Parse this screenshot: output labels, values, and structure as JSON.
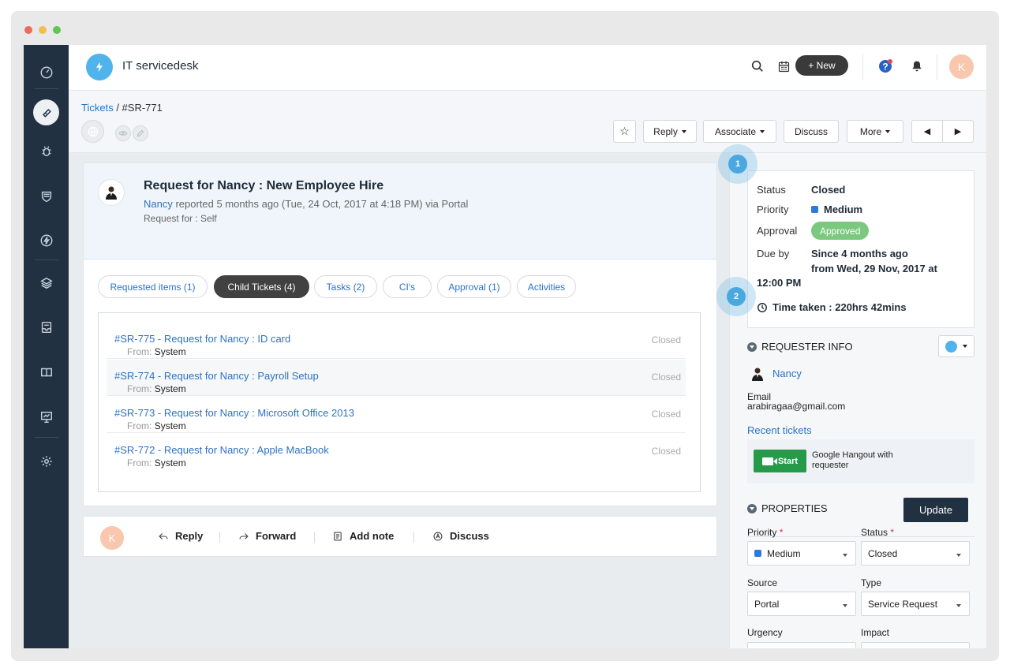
{
  "app": {
    "title": "IT servicedesk"
  },
  "header": {
    "new_label": "+ New",
    "avatar_letter": "K"
  },
  "breadcrumb": {
    "root": "Tickets",
    "separator": " / ",
    "current": "#SR-771"
  },
  "toolbar": {
    "star": "☆",
    "reply": "Reply",
    "associate": "Associate",
    "discuss": "Discuss",
    "more": "More",
    "prev": "◀",
    "next": "▶"
  },
  "ticket": {
    "title": "Request for Nancy : New Employee Hire",
    "requester": "Nancy",
    "meta": " reported 5 months ago (Tue, 24 Oct, 2017 at 4:18 PM) via Portal",
    "request_for": "Request for : Self"
  },
  "tabs": [
    {
      "label": "Requested items (1)"
    },
    {
      "label": "Child Tickets (4)"
    },
    {
      "label": "Tasks  (2)"
    },
    {
      "label": "CI's"
    },
    {
      "label": "Approval  (1)"
    },
    {
      "label": "Activities"
    }
  ],
  "child_tickets": {
    "from_label": "From:",
    "rows": [
      {
        "title": "#SR-775 - Request for Nancy : ID card",
        "from": "System",
        "status": "Closed"
      },
      {
        "title": "#SR-774 - Request for Nancy : Payroll Setup",
        "from": "System",
        "status": "Closed"
      },
      {
        "title": "#SR-773 - Request for Nancy : Microsoft Office 2013",
        "from": "System",
        "status": "Closed"
      },
      {
        "title": "#SR-772 - Request for Nancy : Apple MacBook",
        "from": "System",
        "status": "Closed"
      }
    ]
  },
  "actions": {
    "avatar_letter": "K",
    "reply": "Reply",
    "forward": "Forward",
    "add_note": "Add note",
    "discuss": "Discuss"
  },
  "status_card": {
    "status_label": "Status",
    "status_value": "Closed",
    "priority_label": "Priority",
    "priority_value": "Medium",
    "approval_label": "Approval",
    "approval_value": "Approved",
    "due_label": "Due by",
    "due_value_1": "Since 4 months ago",
    "due_value_2": "from Wed, 29 Nov, 2017 at",
    "due_value_3": "12:00 PM",
    "time_taken": "Time taken : 220hrs 42mins"
  },
  "callouts": {
    "one": "1",
    "two": "2"
  },
  "requester_info": {
    "title": "REQUESTER INFO",
    "name": "Nancy",
    "email_label": "Email",
    "email": "arabiragaa@gmail.com",
    "recent_tickets": "Recent tickets",
    "start_label": "Start",
    "hangout_text": "Google Hangout with requester"
  },
  "properties": {
    "title": "PROPERTIES",
    "update_label": "Update",
    "priority_label": "Priority",
    "priority_value": "Medium",
    "status_label": "Status",
    "status_value": "Closed",
    "source_label": "Source",
    "source_value": "Portal",
    "type_label": "Type",
    "type_value": "Service Request",
    "urgency_label": "Urgency",
    "impact_label": "Impact",
    "required_mark": "*"
  },
  "colors": {
    "sidebar": "#223142",
    "accent": "#2c72c7",
    "approved": "#7bc97e",
    "priority_medium": "#2c7ae0",
    "start_button": "#279a4a"
  }
}
